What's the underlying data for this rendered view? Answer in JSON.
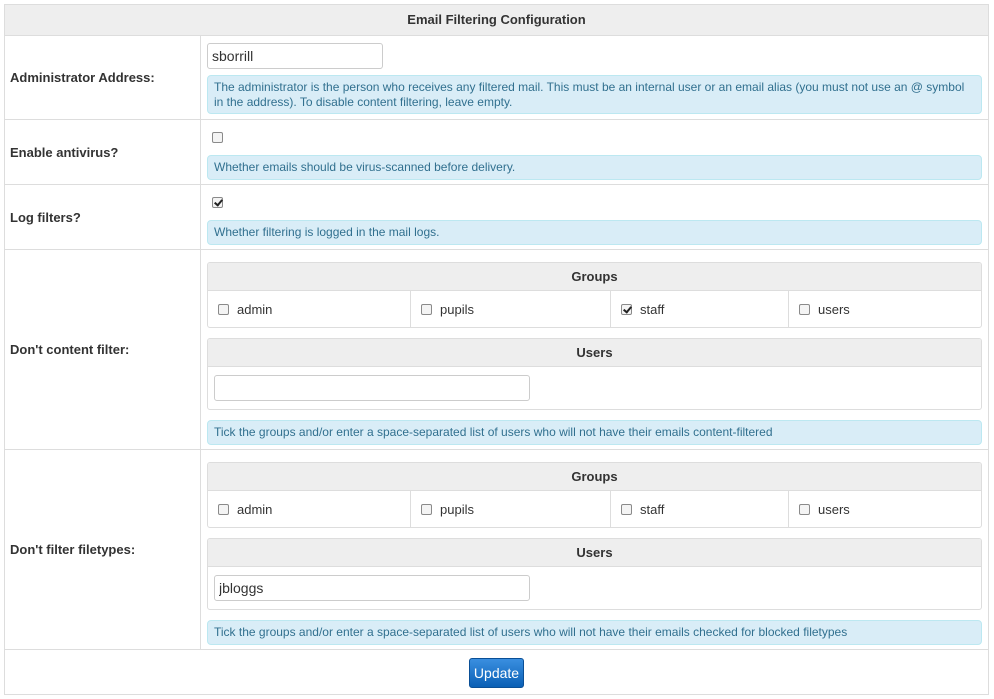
{
  "title": "Email Filtering Configuration",
  "admin": {
    "label": "Administrator Address:",
    "value": "sborrill",
    "help": "The administrator is the person who receives any filtered mail. This must be an internal user or an email alias (you must not use an @ symbol in the address). To disable content filtering, leave empty."
  },
  "antivirus": {
    "label": "Enable antivirus?",
    "checked": false,
    "help": "Whether emails should be virus-scanned before delivery."
  },
  "log_filters": {
    "label": "Log filters?",
    "checked": true,
    "help": "Whether filtering is logged in the mail logs."
  },
  "no_content_filter": {
    "label": "Don't content filter:",
    "groups_header": "Groups",
    "groups": [
      {
        "name": "admin",
        "checked": false
      },
      {
        "name": "pupils",
        "checked": false
      },
      {
        "name": "staff",
        "checked": true
      },
      {
        "name": "users",
        "checked": false
      }
    ],
    "users_header": "Users",
    "users_value": "",
    "help": "Tick the groups and/or enter a space-separated list of users who will not have their emails content-filtered"
  },
  "no_filetype_filter": {
    "label": "Don't filter filetypes:",
    "groups_header": "Groups",
    "groups": [
      {
        "name": "admin",
        "checked": false
      },
      {
        "name": "pupils",
        "checked": false
      },
      {
        "name": "staff",
        "checked": false
      },
      {
        "name": "users",
        "checked": false
      }
    ],
    "users_header": "Users",
    "users_value": "jbloggs",
    "help": "Tick the groups and/or enter a space-separated list of users who will not have their emails checked for blocked filetypes"
  },
  "update_button": "Update",
  "colors": {
    "header_bg": "#eeeeee",
    "help_bg": "#d9edf7",
    "help_text": "#31708f",
    "button": "#0e6fc7"
  }
}
